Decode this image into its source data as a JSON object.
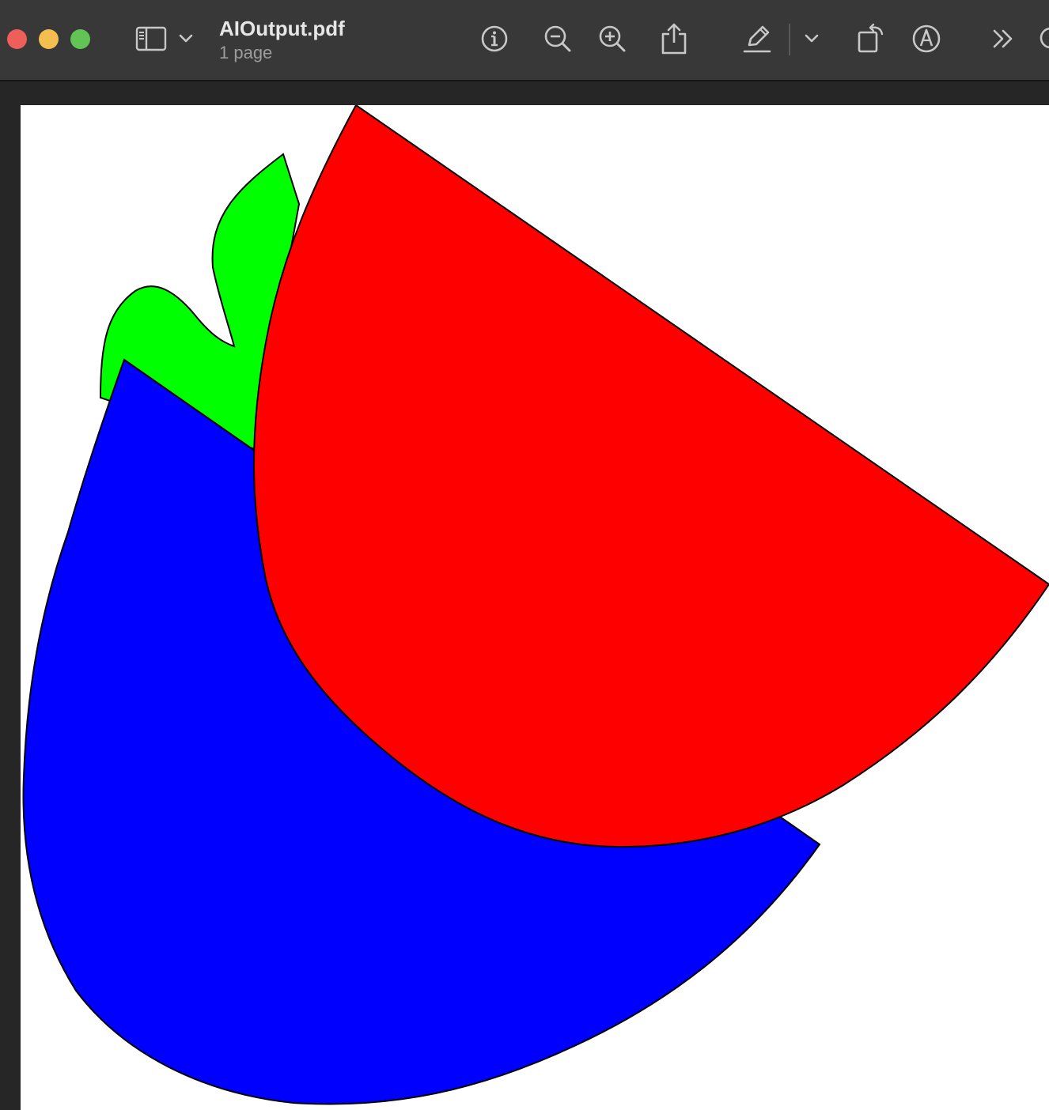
{
  "window": {
    "title": "AIOutput.pdf",
    "subtitle": "1 page"
  },
  "toolbar": {
    "icons": [
      "sidebar-icon",
      "chevron-down-icon",
      "info-icon",
      "zoom-out-icon",
      "zoom-in-icon",
      "share-icon",
      "markup-pen-icon",
      "chevron-down-icon",
      "rotate-icon",
      "annotate-icon",
      "more-icon",
      "search-icon"
    ]
  },
  "document": {
    "background": "#ffffff",
    "shapes": [
      {
        "name": "green-leaf-shape",
        "color": "#00ff00"
      },
      {
        "name": "blue-shape",
        "color": "#0000ff"
      },
      {
        "name": "red-shape",
        "color": "#ff0000"
      }
    ]
  },
  "colors": {
    "toolbar_bg": "#383838",
    "window_bg": "#262626",
    "close": "#ee5f59",
    "minimize": "#f5bf4f",
    "zoom": "#61c454",
    "icon": "#c8c8c8"
  }
}
